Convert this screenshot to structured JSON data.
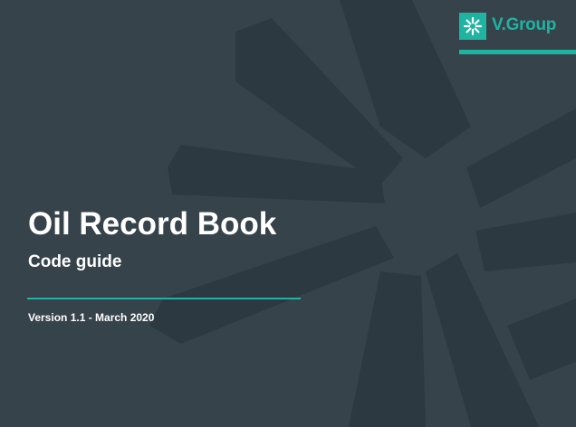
{
  "cover": {
    "title": "Oil Record Book",
    "subtitle": "Code guide",
    "version": "Version 1.1 - March 2020"
  },
  "logo": {
    "text": "V.Group",
    "icon": "v-group-emblem-icon"
  },
  "colors": {
    "background": "#36434b",
    "background_mark": "#2d3940",
    "accent": "#1fb3a2",
    "text": "#ffffff"
  }
}
